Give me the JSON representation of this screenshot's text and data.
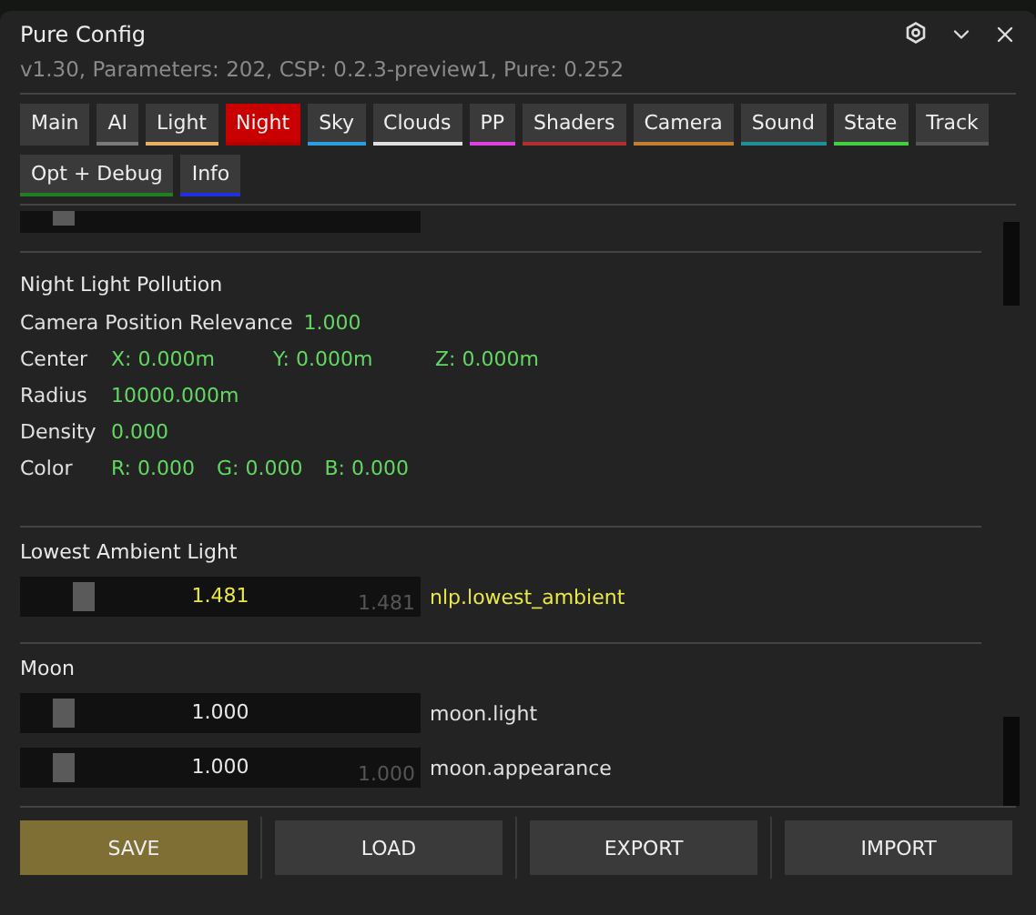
{
  "window": {
    "title": "Pure Config",
    "subtitle": "v1.30, Parameters: 202, CSP: 0.2.3-preview1, Pure: 0.252"
  },
  "tabs": [
    {
      "label": "Main",
      "selected": false
    },
    {
      "label": "AI",
      "selected": false,
      "color": "#7a7a7a"
    },
    {
      "label": "Light",
      "selected": false,
      "color": "#e8b060"
    },
    {
      "label": "Night",
      "selected": true,
      "color": "#b00000"
    },
    {
      "label": "Sky",
      "selected": false,
      "color": "#2a9ee0"
    },
    {
      "label": "Clouds",
      "selected": false,
      "color": "#e0e0e0"
    },
    {
      "label": "PP",
      "selected": false,
      "color": "#e040e0"
    },
    {
      "label": "Shaders",
      "selected": false,
      "color": "#b03030"
    },
    {
      "label": "Camera",
      "selected": false,
      "color": "#c08030"
    },
    {
      "label": "Sound",
      "selected": false,
      "color": "#209098"
    },
    {
      "label": "State",
      "selected": false,
      "color": "#40d040"
    },
    {
      "label": "Track",
      "selected": false,
      "color": "#555555"
    },
    {
      "label": "Opt + Debug",
      "selected": false,
      "color": "#208020"
    },
    {
      "label": "Info",
      "selected": false,
      "color": "#2030e0"
    }
  ],
  "sections": [
    {
      "kind": "cut_slider",
      "level": 0.12
    },
    {
      "kind": "fields",
      "title": "Night Light Pollution",
      "rows": [
        {
          "kind": "inline",
          "label": "Camera Position Relevance",
          "values": [
            "1.000"
          ]
        },
        {
          "kind": "vector",
          "label": "Center",
          "values": [
            "X: 0.000m",
            "Y: 0.000m",
            "Z: 0.000m"
          ]
        },
        {
          "kind": "inline",
          "label": "Radius",
          "values": [
            "10000.000m"
          ]
        },
        {
          "kind": "inline",
          "label": "Density",
          "values": [
            "0.000"
          ]
        },
        {
          "kind": "inline",
          "label": "Color",
          "values": [
            "R: 0.000",
            "G: 0.000",
            "B: 0.000"
          ]
        }
      ]
    },
    {
      "kind": "sliders",
      "title": "Lowest Ambient Light",
      "items": [
        {
          "value": "1.481",
          "default": "1.481",
          "name": "nlp.lowest_ambient",
          "level": 0.17,
          "modified": true
        }
      ]
    },
    {
      "kind": "sliders",
      "title": "Moon",
      "items": [
        {
          "value": "1.000",
          "name": "moon.light",
          "level": 0.12,
          "modified": false
        },
        {
          "value": "1.000",
          "default": "1.000",
          "name": "moon.appearance",
          "level": 0.12,
          "modified": false
        }
      ]
    }
  ],
  "buttons": [
    {
      "label": "SAVE",
      "primary": true
    },
    {
      "label": "LOAD",
      "primary": false
    },
    {
      "label": "EXPORT",
      "primary": false
    },
    {
      "label": "IMPORT",
      "primary": false
    }
  ]
}
